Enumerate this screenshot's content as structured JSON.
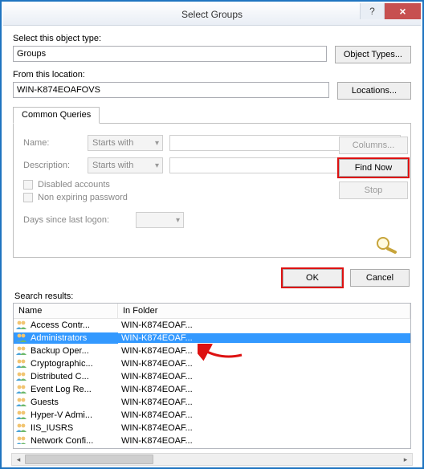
{
  "title": "Select Groups",
  "object_type_label": "Select this object type:",
  "object_type_value": "Groups",
  "object_types_btn": "Object Types...",
  "location_label": "From this location:",
  "location_value": "WIN-K874EOAFOVS",
  "locations_btn": "Locations...",
  "tab_label": "Common Queries",
  "form": {
    "name_label": "Name:",
    "name_combo": "Starts with",
    "desc_label": "Description:",
    "desc_combo": "Starts with",
    "disabled_check": "Disabled accounts",
    "nonexp_check": "Non expiring password",
    "logon_label": "Days since last logon:"
  },
  "buttons": {
    "columns": "Columns...",
    "find_now": "Find Now",
    "stop": "Stop",
    "ok": "OK",
    "cancel": "Cancel"
  },
  "results_label": "Search results:",
  "columns": {
    "name": "Name",
    "folder": "In Folder"
  },
  "results": [
    {
      "name": "Access Contr...",
      "folder": "WIN-K874EOAF...",
      "selected": false
    },
    {
      "name": "Administrators",
      "folder": "WIN-K874EOAF...",
      "selected": true
    },
    {
      "name": "Backup Oper...",
      "folder": "WIN-K874EOAF...",
      "selected": false
    },
    {
      "name": "Cryptographic...",
      "folder": "WIN-K874EOAF...",
      "selected": false
    },
    {
      "name": "Distributed C...",
      "folder": "WIN-K874EOAF...",
      "selected": false
    },
    {
      "name": "Event Log Re...",
      "folder": "WIN-K874EOAF...",
      "selected": false
    },
    {
      "name": "Guests",
      "folder": "WIN-K874EOAF...",
      "selected": false
    },
    {
      "name": "Hyper-V Admi...",
      "folder": "WIN-K874EOAF...",
      "selected": false
    },
    {
      "name": "IIS_IUSRS",
      "folder": "WIN-K874EOAF...",
      "selected": false
    },
    {
      "name": "Network Confi...",
      "folder": "WIN-K874EOAF...",
      "selected": false
    }
  ]
}
